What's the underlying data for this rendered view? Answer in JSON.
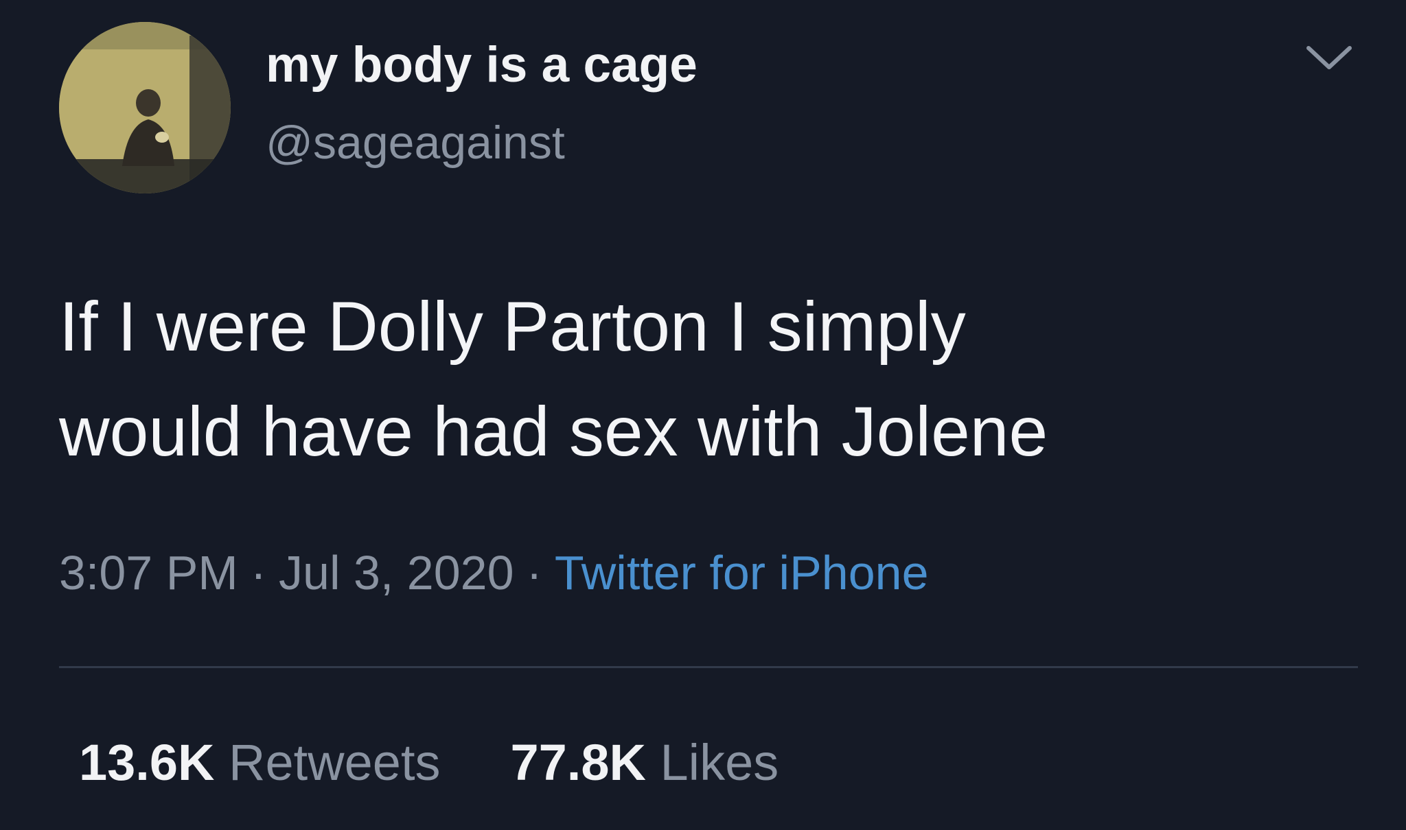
{
  "tweet": {
    "author": {
      "display_name": "my body is a cage",
      "handle": "@sageagainst"
    },
    "menu_icon": "chevron-down-icon",
    "text_lines": [
      "If I were Dolly Parton I simply",
      "would have had sex with Jolene"
    ],
    "meta": {
      "time": "3:07 PM",
      "date": "Jul 3, 2020",
      "source": "Twitter for iPhone",
      "separator": "·"
    },
    "stats": {
      "retweets_count": "13.6K",
      "retweets_label": "Retweets",
      "likes_count": "77.8K",
      "likes_label": "Likes"
    }
  },
  "colors": {
    "background": "#151a26",
    "primary_text": "#f2f3f5",
    "secondary_text": "#8a93a1",
    "link": "#4a90cf",
    "divider": "#313a4a"
  }
}
